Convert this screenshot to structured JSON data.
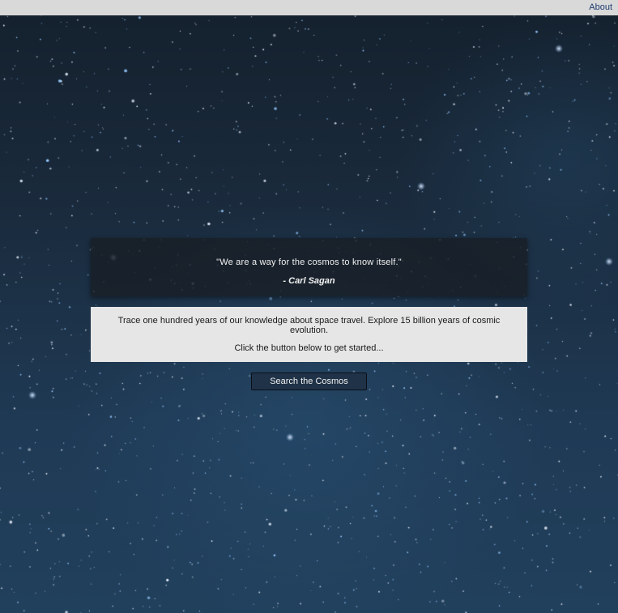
{
  "nav": {
    "about_label": "About"
  },
  "quote": {
    "text": "\"We are a way for the cosmos to know itself.\"",
    "author": "- Carl Sagan"
  },
  "intro": {
    "description": "Trace one hundred years of our knowledge about space travel. Explore 15 billion years of cosmic evolution.",
    "cta": "Click the button below to get started..."
  },
  "actions": {
    "search_label": "Search the Cosmos"
  },
  "theme": {
    "topbar_bg": "#d9d9d9",
    "link_color": "#1d3b6e",
    "quote_bg": "#191e26",
    "intro_bg": "#e6e6e6",
    "button_bg": "#1f3247"
  }
}
